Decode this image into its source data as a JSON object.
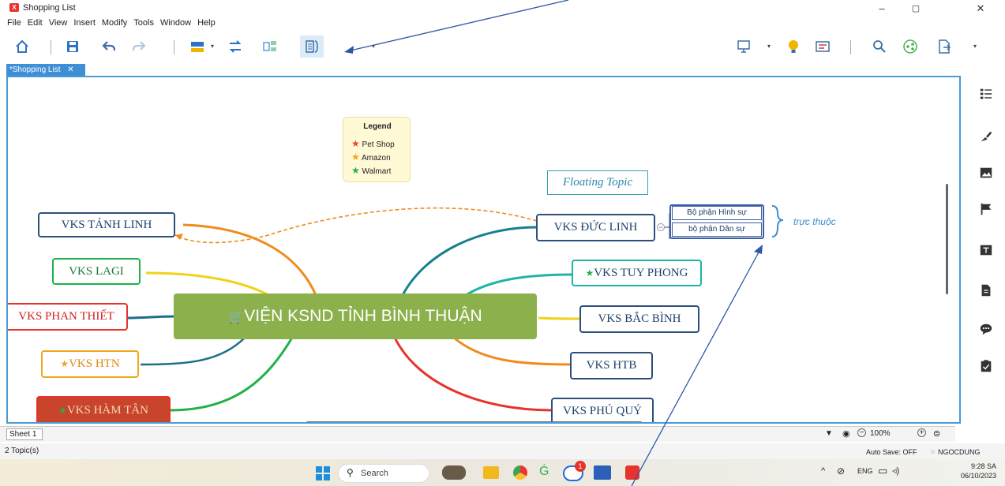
{
  "window": {
    "app_icon_letter": "X",
    "title": "Shopping List",
    "minimize": "–",
    "maximize": "▢",
    "close": "✕"
  },
  "menu": [
    "File",
    "Edit",
    "View",
    "Insert",
    "Modify",
    "Tools",
    "Window",
    "Help"
  ],
  "toolbar": {
    "icons": [
      "home-icon",
      "save-icon",
      "undo-icon",
      "redo-icon",
      "topic-icon",
      "relationship-icon",
      "summary-icon",
      "boundary-icon",
      "presentation-icon",
      "idea-icon",
      "outline-icon",
      "search-icon",
      "share-icon",
      "export-icon"
    ],
    "drop_arrow": "▾"
  },
  "tab": {
    "label": "*Shopping List",
    "close": "✕"
  },
  "mindmap": {
    "central": {
      "icon": "🛒",
      "text": "VIỆN KSND TỈNH BÌNH THUẬN"
    },
    "legend": {
      "title": "Legend",
      "items": [
        {
          "label": "Pet Shop",
          "color": "#e8452f"
        },
        {
          "label": "Amazon",
          "color": "#f0a520"
        },
        {
          "label": "Walmart",
          "color": "#22b04b"
        }
      ]
    },
    "floating": "Floating Topic",
    "left_topics": [
      "VKS TÁNH LINH",
      "VKS LAGI",
      "VKS PHAN THIẾT",
      "VKS HTN",
      "VKS HÀM TÂN"
    ],
    "right_topics": [
      "VKS ĐỨC LINH",
      "VKS TUY PHONG",
      "VKS BẮC BÌNH",
      "VKS HTB",
      "VKS PHÚ QUÝ"
    ],
    "subtopics": [
      "Bộ phận Hình sự",
      "bộ phận Dân sự"
    ],
    "summary": "trực thuộc",
    "star": "★",
    "collapse": "−"
  },
  "right_panel": [
    "outline-panel-icon",
    "format-icon",
    "image-icon",
    "marker-icon",
    "text-icon",
    "notes-icon",
    "comment-icon",
    "task-icon"
  ],
  "sheet": {
    "name": "Sheet 1",
    "zoom": "100%",
    "zoom_out": "−",
    "zoom_in": "+"
  },
  "status": {
    "topics": "2 Topic(s)",
    "autosave": "Auto Save: OFF",
    "user": "NGOCDUNG"
  },
  "taskbar": {
    "search_placeholder": "Search",
    "lang": "ENG",
    "time": "9:28 SA",
    "date": "06/10/2023",
    "badge": "1"
  },
  "colors": {
    "accent": "#4a9ad6",
    "central": "#8cb04c",
    "node_border": "#2d4f7c"
  }
}
